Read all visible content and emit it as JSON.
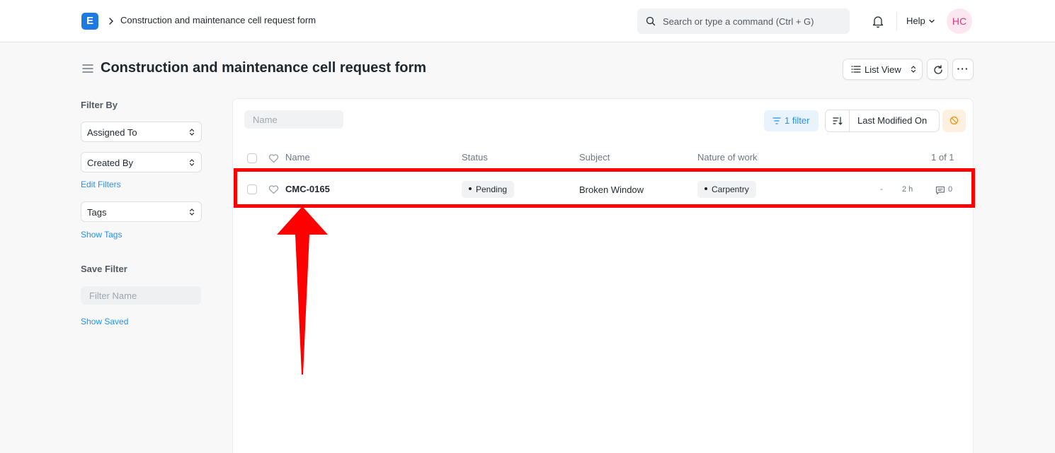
{
  "navbar": {
    "logo_letter": "E",
    "breadcrumb": "Construction and maintenance cell request form",
    "search_placeholder": "Search or type a command (Ctrl + G)",
    "help_label": "Help",
    "avatar_initials": "HC"
  },
  "page": {
    "title": "Construction and maintenance cell request form",
    "list_view_label": "List View"
  },
  "sidebar": {
    "filter_by_heading": "Filter By",
    "filters": [
      "Assigned To",
      "Created By"
    ],
    "edit_filters_link": "Edit Filters",
    "tags_label": "Tags",
    "show_tags_link": "Show Tags",
    "save_filter_heading": "Save Filter",
    "filter_name_placeholder": "Filter Name",
    "show_saved_link": "Show Saved"
  },
  "list": {
    "name_filter_placeholder": "Name",
    "filter_button_label": "1 filter",
    "sort_label": "Last Modified On",
    "columns": {
      "name": "Name",
      "status": "Status",
      "subject": "Subject",
      "nature_of_work": "Nature of work",
      "count": "1 of 1"
    },
    "rows": [
      {
        "name": "CMC-0165",
        "status": "Pending",
        "subject": "Broken Window",
        "nature_of_work": "Carpentry",
        "assigned": "-",
        "modified": "2 h",
        "comments": "0"
      }
    ]
  },
  "colors": {
    "accent": "#2490ef",
    "brand": "#1f7ae0",
    "annotation": "#ff0000"
  }
}
